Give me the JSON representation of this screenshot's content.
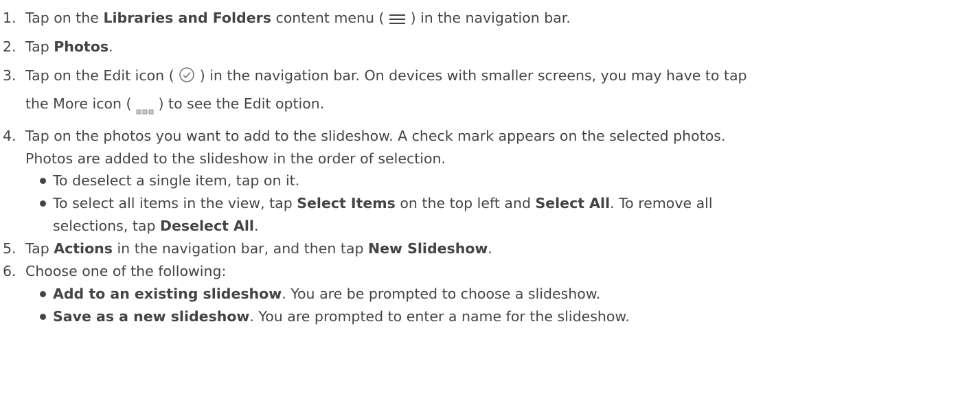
{
  "steps": [
    {
      "num": "1.",
      "pre": "Tap on the ",
      "bold1": "Libraries and Folders",
      "mid": " content menu ( ",
      "icon": "hamburger-menu-icon",
      "post": " ) in the navigation bar."
    },
    {
      "num": "2.",
      "pre": "Tap ",
      "bold1": "Photos",
      "post": "."
    },
    {
      "num": "3.",
      "pre": "Tap on the Edit icon ( ",
      "icon": "check-circle-icon",
      "post": " ) in the navigation bar. On devices with smaller screens, you may have to tap",
      "line2pre": "the More icon ( ",
      "icon2": "more-dots-icon",
      "line2post": " ) to see the Edit option."
    },
    {
      "num": "4.",
      "line1": "Tap on the photos you want to add to the slideshow. A check mark appears on the selected photos.",
      "line2": "Photos are added to the slideshow in the order of selection.",
      "bullets": [
        {
          "text": "To deselect a single item, tap on it."
        },
        {
          "pre": "To select all items in the view, tap ",
          "bold1": "Select Items",
          "mid": " on the top left and ",
          "bold2": "Select All",
          "post": ". To remove all",
          "line2pre": "selections, tap ",
          "line2bold": "Deselect All",
          "line2post": "."
        }
      ]
    },
    {
      "num": "5.",
      "pre": "Tap ",
      "bold1": "Actions",
      "mid": " in the navigation bar, and then tap ",
      "bold2": "New Slideshow",
      "post": "."
    },
    {
      "num": "6.",
      "line1": "Choose one of the following:",
      "bullets": [
        {
          "bold1": "Add to an existing slideshow",
          "post": ". You are be prompted to choose a slideshow."
        },
        {
          "bold1": "Save as a new slideshow",
          "post": ". You are prompted to enter a name for the slideshow."
        }
      ]
    }
  ],
  "colors": {
    "text": "#444444",
    "icon": "#555555"
  }
}
